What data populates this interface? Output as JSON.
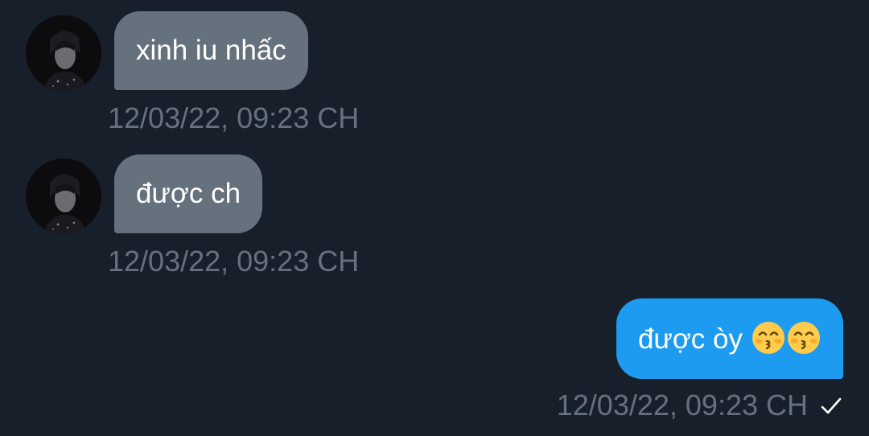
{
  "colors": {
    "background": "#17202a",
    "incoming_bubble": "#66717e",
    "outgoing_bubble": "#1d9bf0",
    "timestamp": "#66717e",
    "text": "#ffffff"
  },
  "messages": [
    {
      "direction": "incoming",
      "avatar_icon": "profile-photo",
      "text": "xinh iu nhấc",
      "timestamp": "12/03/22, 09:23 CH"
    },
    {
      "direction": "incoming",
      "avatar_icon": "profile-photo",
      "text": "được ch",
      "timestamp": "12/03/22, 09:23 CH"
    },
    {
      "direction": "outgoing",
      "text": "được òy",
      "emojis": [
        "kissing-face-with-smiling-eyes-icon",
        "kissing-face-with-smiling-eyes-icon"
      ],
      "timestamp": "12/03/22, 09:23 CH",
      "status_icon": "checkmark-icon"
    }
  ]
}
